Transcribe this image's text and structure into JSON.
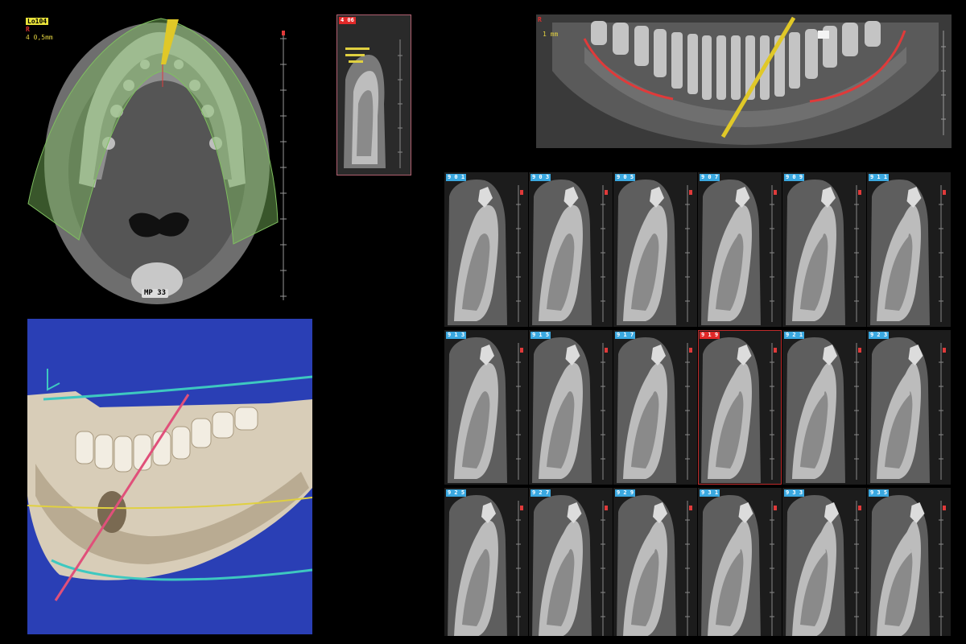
{
  "axial": {
    "label_tag": "Lo104",
    "label_line2": "R",
    "label_line3": "4 0,5mm",
    "mpr_badge": "MP 33"
  },
  "oblique": {
    "badge": "4 06"
  },
  "panoramic": {
    "side_marker": "R",
    "label": "1 mm"
  },
  "cross_sections": {
    "rows": [
      {
        "cells": [
          {
            "badge": "9 0 1",
            "selected": false
          },
          {
            "badge": "9 0 3",
            "selected": false
          },
          {
            "badge": "9 0 5",
            "selected": false
          },
          {
            "badge": "9 0 7",
            "selected": false
          },
          {
            "badge": "9 0 9",
            "selected": false
          },
          {
            "badge": "9 1 1",
            "selected": false
          }
        ]
      },
      {
        "cells": [
          {
            "badge": "9 1 3",
            "selected": false
          },
          {
            "badge": "9 1 5",
            "selected": false
          },
          {
            "badge": "9 1 7",
            "selected": false
          },
          {
            "badge": "9 1 9",
            "selected": true
          },
          {
            "badge": "9 2 1",
            "selected": false
          },
          {
            "badge": "9 2 3",
            "selected": false
          }
        ]
      },
      {
        "cells": [
          {
            "badge": "9 2 5",
            "selected": false
          },
          {
            "badge": "9 2 7",
            "selected": false
          },
          {
            "badge": "9 2 9",
            "selected": false
          },
          {
            "badge": "9 3 1",
            "selected": false
          },
          {
            "badge": "9 3 3",
            "selected": false
          },
          {
            "badge": "9 3 5",
            "selected": false
          }
        ]
      }
    ]
  },
  "colors": {
    "background": "#000000",
    "volume_bg": "#2a3fb5",
    "nerve_canal": "#e03a3a",
    "planning_line": "#e0c828",
    "arch_band": "#7fbf60",
    "selection": "#c02a2a",
    "badge_blue": "#3aa8e0"
  }
}
